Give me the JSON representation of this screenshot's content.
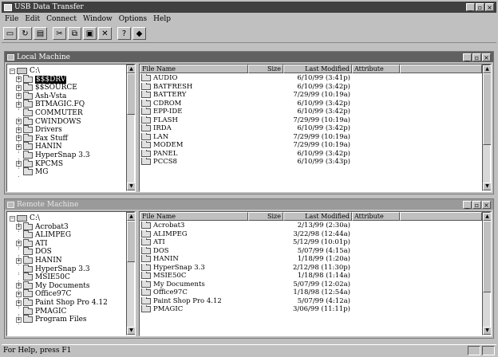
{
  "app": {
    "title": "USB Data Transfer"
  },
  "menu": [
    "File",
    "Edit",
    "Connect",
    "Window",
    "Options",
    "Help"
  ],
  "toolbar": {
    "buttons": [
      {
        "name": "new-connection-button",
        "icon": "monitor-icon",
        "glyph": "▭"
      },
      {
        "name": "refresh-button",
        "icon": "refresh-icon",
        "glyph": "↻"
      },
      {
        "name": "properties-button",
        "icon": "properties-icon",
        "glyph": "▤"
      },
      {
        "name": "cut-button",
        "icon": "cut-icon",
        "glyph": "✂"
      },
      {
        "name": "copy-button",
        "icon": "copy-icon",
        "glyph": "⧉"
      },
      {
        "name": "paste-button",
        "icon": "paste-icon",
        "glyph": "▣"
      },
      {
        "name": "delete-button",
        "icon": "delete-icon",
        "glyph": "✕"
      },
      {
        "name": "help-button",
        "icon": "help-icon",
        "glyph": "?"
      },
      {
        "name": "connect-button",
        "icon": "connect-icon",
        "glyph": "◆"
      }
    ]
  },
  "columns": {
    "name": "File Name",
    "size": "Size",
    "modified": "Last Modified",
    "attr": "Attribute"
  },
  "local": {
    "title": "Local Machine",
    "root": "C:\\",
    "tree": [
      {
        "label": "$$$DRV",
        "expander": "+",
        "selected": true
      },
      {
        "label": "$$SOURCE",
        "expander": "+"
      },
      {
        "label": "Ash-Vsta",
        "expander": "+"
      },
      {
        "label": "BTMAGIC.FQ",
        "expander": "+"
      },
      {
        "label": "COMMUTER",
        "expander": ""
      },
      {
        "label": "CWINDOWS",
        "expander": "+"
      },
      {
        "label": "Drivers",
        "expander": "+"
      },
      {
        "label": "Fax Stuff",
        "expander": "+"
      },
      {
        "label": "HANIN",
        "expander": "+"
      },
      {
        "label": "HyperSnap 3.3",
        "expander": ""
      },
      {
        "label": "KPCMS",
        "expander": "+"
      },
      {
        "label": "MG",
        "expander": ""
      }
    ],
    "files": [
      {
        "name": "AUDIO",
        "size": "",
        "modified": "6/10/99 (3:41p)",
        "attr": ""
      },
      {
        "name": "BATFRESH",
        "size": "",
        "modified": "6/10/99 (3:42p)",
        "attr": ""
      },
      {
        "name": "BATTERY",
        "size": "",
        "modified": "7/29/99 (10:19a)",
        "attr": ""
      },
      {
        "name": "CDROM",
        "size": "",
        "modified": "6/10/99 (3:42p)",
        "attr": ""
      },
      {
        "name": "EPP-IDE",
        "size": "",
        "modified": "6/10/99 (3:42p)",
        "attr": ""
      },
      {
        "name": "FLASH",
        "size": "",
        "modified": "7/29/99 (10:19a)",
        "attr": ""
      },
      {
        "name": "IRDA",
        "size": "",
        "modified": "6/10/99 (3:42p)",
        "attr": ""
      },
      {
        "name": "LAN",
        "size": "",
        "modified": "7/29/99 (10:19a)",
        "attr": ""
      },
      {
        "name": "MODEM",
        "size": "",
        "modified": "7/29/99 (10:19a)",
        "attr": ""
      },
      {
        "name": "PANEL",
        "size": "",
        "modified": "6/10/99 (3:42p)",
        "attr": ""
      },
      {
        "name": "PCCS8",
        "size": "",
        "modified": "6/10/99 (3:43p)",
        "attr": ""
      }
    ]
  },
  "remote": {
    "title": "Remote Machine",
    "root": "C:\\",
    "tree": [
      {
        "label": "Acrobat3",
        "expander": "+"
      },
      {
        "label": "ALIMPEG",
        "expander": ""
      },
      {
        "label": "ATI",
        "expander": "+"
      },
      {
        "label": "DOS",
        "expander": ""
      },
      {
        "label": "HANIN",
        "expander": "+"
      },
      {
        "label": "HyperSnap 3.3",
        "expander": ""
      },
      {
        "label": "MSIE50C",
        "expander": ""
      },
      {
        "label": "My Documents",
        "expander": "+"
      },
      {
        "label": "Office97C",
        "expander": "+"
      },
      {
        "label": "Paint Shop Pro 4.12",
        "expander": "+"
      },
      {
        "label": "PMAGIC",
        "expander": ""
      },
      {
        "label": "Program Files",
        "expander": "+"
      }
    ],
    "files": [
      {
        "name": "Acrobat3",
        "size": "",
        "modified": "2/13/99 (2:30a)",
        "attr": ""
      },
      {
        "name": "ALIMPEG",
        "size": "",
        "modified": "3/22/98 (12:44a)",
        "attr": ""
      },
      {
        "name": "ATI",
        "size": "",
        "modified": "5/12/99 (10:01p)",
        "attr": ""
      },
      {
        "name": "DOS",
        "size": "",
        "modified": "5/07/99 (4:15a)",
        "attr": ""
      },
      {
        "name": "HANIN",
        "size": "",
        "modified": "1/18/99 (1:20a)",
        "attr": ""
      },
      {
        "name": "HyperSnap 3.3",
        "size": "",
        "modified": "2/12/98 (11:30p)",
        "attr": ""
      },
      {
        "name": "MSIE50C",
        "size": "",
        "modified": "1/18/98 (1:14a)",
        "attr": ""
      },
      {
        "name": "My Documents",
        "size": "",
        "modified": "5/07/99 (12:02a)",
        "attr": ""
      },
      {
        "name": "Office97C",
        "size": "",
        "modified": "1/18/98 (12:54a)",
        "attr": ""
      },
      {
        "name": "Paint Shop Pro 4.12",
        "size": "",
        "modified": "5/07/99 (4:12a)",
        "attr": ""
      },
      {
        "name": "PMAGIC",
        "size": "",
        "modified": "3/06/99 (11:11p)",
        "attr": ""
      }
    ]
  },
  "status": {
    "text": "For Help, press F1"
  }
}
